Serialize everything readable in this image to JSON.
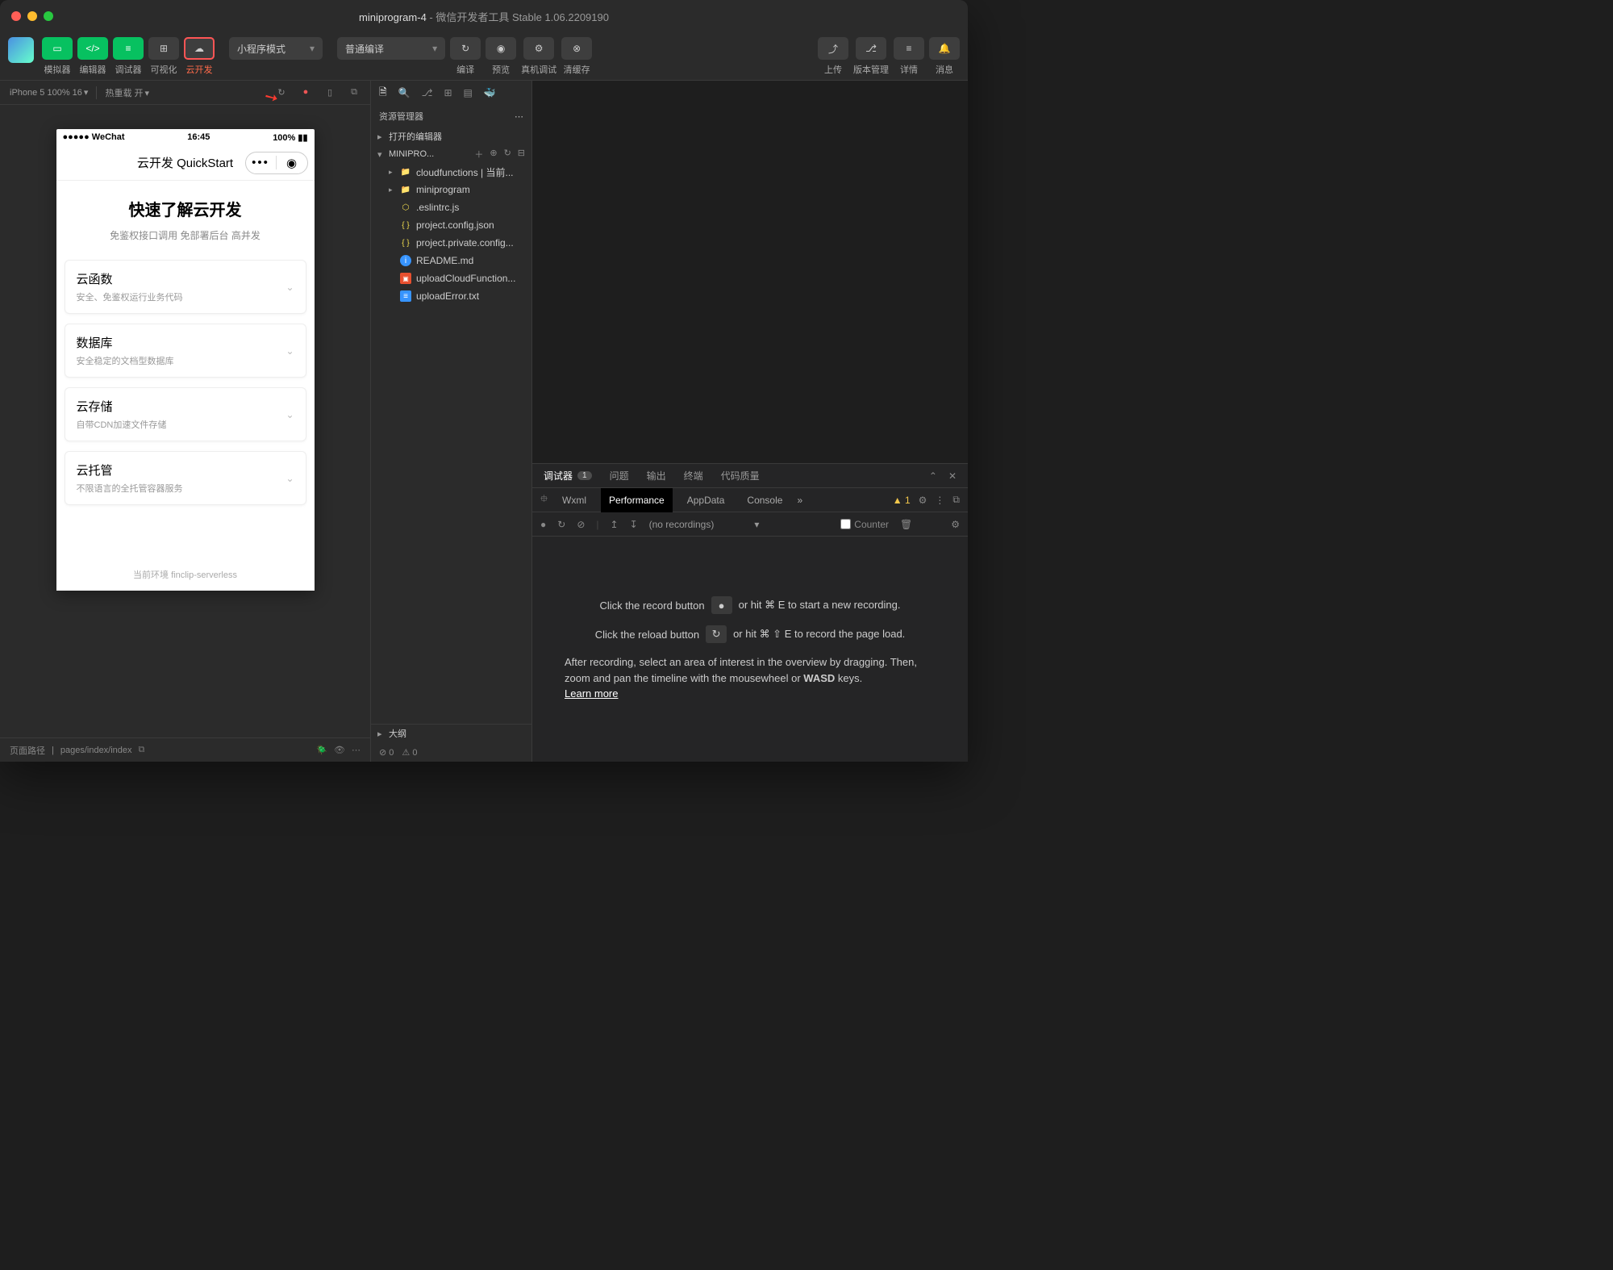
{
  "titlebar": {
    "project": "miniprogram-4",
    "app": " - 微信开发者工具 Stable 1.06.2209190"
  },
  "toolbar": {
    "simulator": "模拟器",
    "editor": "编辑器",
    "debugger": "调试器",
    "visual": "可视化",
    "cloud": "云开发",
    "mode": "小程序模式",
    "compile_mode": "普通编译",
    "compile": "编译",
    "preview": "预览",
    "remote": "真机调试",
    "cache": "清缓存",
    "upload": "上传",
    "version": "版本管理",
    "details": "详情",
    "message": "消息"
  },
  "subbar": {
    "device": "iPhone 5 100% 16",
    "hotreload": "热重载 开"
  },
  "phone": {
    "carrier": "WeChat",
    "time": "16:45",
    "battery": "100%",
    "nav_title": "云开发 QuickStart",
    "title": "快速了解云开发",
    "subtitle": "免鉴权接口调用 免部署后台 高并发",
    "cards": [
      {
        "t": "云函数",
        "s": "安全、免鉴权运行业务代码"
      },
      {
        "t": "数据库",
        "s": "安全稳定的文档型数据库"
      },
      {
        "t": "云存储",
        "s": "自带CDN加速文件存储"
      },
      {
        "t": "云托管",
        "s": "不限语言的全托管容器服务"
      }
    ],
    "footer": "当前环境 finclip-serverless"
  },
  "simstatus": {
    "label": "页面路径",
    "path": "pages/index/index"
  },
  "explorer": {
    "title": "资源管理器",
    "open": "打开的编辑器",
    "project": "MINIPRO...",
    "items": [
      {
        "type": "folder-y",
        "name": "cloudfunctions | 当前..."
      },
      {
        "type": "folder",
        "name": "miniprogram"
      },
      {
        "type": "js",
        "name": ".eslintrc.js"
      },
      {
        "type": "json",
        "name": "project.config.json"
      },
      {
        "type": "json",
        "name": "project.private.config..."
      },
      {
        "type": "info",
        "name": "README.md"
      },
      {
        "type": "ps",
        "name": "uploadCloudFunction..."
      },
      {
        "type": "txt",
        "name": "uploadError.txt"
      }
    ],
    "outline": "大纲",
    "err": "0",
    "warn": "0"
  },
  "debugger": {
    "tabs": {
      "main": "调试器",
      "badge": "1",
      "problems": "问题",
      "output": "输出",
      "terminal": "终端",
      "quality": "代码质量"
    },
    "sub": {
      "wxml": "Wxml",
      "perf": "Performance",
      "appdata": "AppData",
      "console": "Console",
      "warn": "1"
    },
    "perfbar": {
      "norec": "(no recordings)",
      "counter": "Counter"
    },
    "body": {
      "l1a": "Click the record button",
      "l1b": "or hit ⌘ E to start a new recording.",
      "l2a": "Click the reload button",
      "l2b": "or hit ⌘ ⇧ E to record the page load.",
      "p1": "After recording, select an area of interest in the overview by dragging. Then, zoom and pan the timeline with the mousewheel or ",
      "p2": "WASD",
      "p3": " keys.",
      "learn": "Learn more"
    }
  }
}
